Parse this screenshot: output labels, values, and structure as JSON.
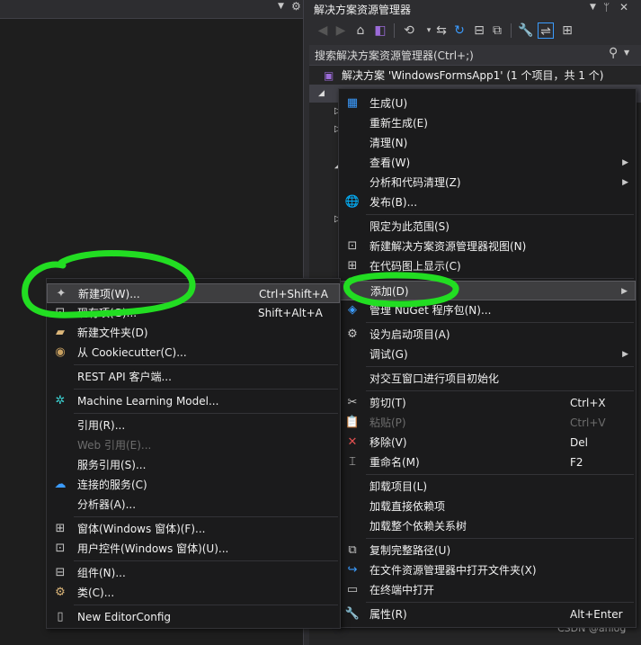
{
  "solution_explorer": {
    "title": "解决方案资源管理器",
    "pin_icon": "pin-icon",
    "close_icon": "close-icon",
    "search_placeholder": "搜索解决方案资源管理器(Ctrl+;)",
    "solution_label": "解决方案 'WindowsFormsApp1' (1 个项目，共 1 个)"
  },
  "context_menu": {
    "items": [
      {
        "label": "生成(U)",
        "icon": "build-icon"
      },
      {
        "label": "重新生成(E)"
      },
      {
        "label": "清理(N)"
      },
      {
        "label": "查看(W)",
        "submenu": true
      },
      {
        "label": "分析和代码清理(Z)",
        "submenu": true
      },
      {
        "label": "发布(B)...",
        "icon": "publish-globe-icon"
      },
      {
        "label": "限定为此范围(S)"
      },
      {
        "label": "新建解决方案资源管理器视图(N)",
        "icon": "new-view-icon"
      },
      {
        "label": "在代码图上显示(C)",
        "icon": "code-map-icon"
      },
      {
        "label": "添加(D)",
        "submenu": true,
        "highlighted": true
      },
      {
        "label": "管理 NuGet 程序包(N)...",
        "icon": "nuget-icon"
      },
      {
        "label": "设为启动项目(A)",
        "icon": "gear-icon"
      },
      {
        "label": "调试(G)",
        "submenu": true
      },
      {
        "label": "对交互窗口进行项目初始化"
      },
      {
        "label": "剪切(T)",
        "shortcut": "Ctrl+X",
        "icon": "cut-icon"
      },
      {
        "label": "粘贴(P)",
        "shortcut": "Ctrl+V",
        "icon": "paste-icon",
        "disabled": true
      },
      {
        "label": "移除(V)",
        "shortcut": "Del",
        "icon": "remove-icon"
      },
      {
        "label": "重命名(M)",
        "shortcut": "F2",
        "icon": "rename-icon"
      },
      {
        "label": "卸载项目(L)"
      },
      {
        "label": "加载直接依赖项"
      },
      {
        "label": "加载整个依赖关系树"
      },
      {
        "label": "复制完整路径(U)",
        "icon": "copy-icon"
      },
      {
        "label": "在文件资源管理器中打开文件夹(X)",
        "icon": "open-folder-icon"
      },
      {
        "label": "在终端中打开",
        "icon": "terminal-icon"
      },
      {
        "label": "属性(R)",
        "shortcut": "Alt+Enter",
        "icon": "wrench-icon"
      }
    ]
  },
  "add_submenu": {
    "items": [
      {
        "label": "新建项(W)...",
        "shortcut": "Ctrl+Shift+A",
        "icon": "new-item-icon",
        "highlighted": true
      },
      {
        "label": "现有项(G)...",
        "shortcut": "Shift+Alt+A",
        "icon": "existing-item-icon"
      },
      {
        "label": "新建文件夹(D)",
        "icon": "new-folder-icon"
      },
      {
        "label": "从 Cookiecutter(C)...",
        "icon": "cookiecutter-icon"
      },
      {
        "label": "REST API 客户端..."
      },
      {
        "label": "Machine Learning Model...",
        "icon": "ml-model-icon"
      },
      {
        "label": "引用(R)..."
      },
      {
        "label": "Web 引用(E)...",
        "disabled": true
      },
      {
        "label": "服务引用(S)..."
      },
      {
        "label": "连接的服务(C)",
        "icon": "connected-service-icon"
      },
      {
        "label": "分析器(A)..."
      },
      {
        "label": "窗体(Windows 窗体)(F)...",
        "icon": "form-icon"
      },
      {
        "label": "用户控件(Windows 窗体)(U)...",
        "icon": "user-control-icon"
      },
      {
        "label": "组件(N)...",
        "icon": "component-icon"
      },
      {
        "label": "类(C)...",
        "icon": "class-icon"
      },
      {
        "label": "New EditorConfig",
        "icon": "editorconfig-file-icon"
      }
    ]
  },
  "watermark": "CSDN @anlog",
  "colors": {
    "annotation_green": "#22dd22",
    "menu_bg": "#1b1b1c",
    "highlight_bg": "#3e3e40"
  }
}
